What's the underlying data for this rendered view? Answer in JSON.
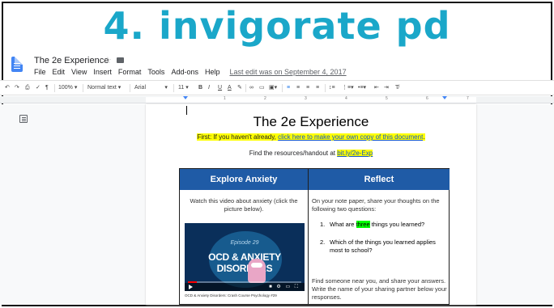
{
  "banner": {
    "text": "4. invigorate pd"
  },
  "docs": {
    "title": "The 2e Experience",
    "menu": [
      "File",
      "Edit",
      "View",
      "Insert",
      "Format",
      "Tools",
      "Add-ons",
      "Help"
    ],
    "last_edit": "Last edit was on September 4, 2017",
    "toolbar": {
      "zoom": "100%",
      "style": "Normal text",
      "font": "Arial",
      "size": "11",
      "bold": "B",
      "italic": "I",
      "underline": "U",
      "text_color": "A"
    },
    "ruler_numbers": [
      "1",
      "2",
      "3",
      "4",
      "5",
      "6",
      "7"
    ]
  },
  "document": {
    "heading": "The 2e Experience",
    "first_prefix": "First: If you haven't already, ",
    "first_link": "click here to make your own copy of this document",
    "first_suffix": ".",
    "resources_prefix": "Find the resources/handout at ",
    "resources_link": "bit.ly/2e-Exp",
    "table": {
      "col_a_header": "Explore Anxiety",
      "col_b_header": "Reflect",
      "col_a_text": "Watch this video about anxiety (click the picture below).",
      "video": {
        "episode": "Episode 29",
        "title": "OCD & ANXIETY DISORDERS",
        "progress": 0.08,
        "caption": "OCD & Anxiety Disorders: Crash Course Psychology #29"
      },
      "col_b_intro": "On your note paper, share your thoughts on the following two questions:",
      "q1_num": "1.",
      "q1_before": "What are ",
      "q1_highlight": "three",
      "q1_after": " things you learned?",
      "q2_num": "2.",
      "q2_text": "Which of the things you learned applies most to school?",
      "col_b_outro": "Find someone near you, and share your answers. Write the name of your sharing partner below your responses."
    }
  },
  "colors": {
    "banner": "#1aa7c9",
    "table_header": "#1f5ba6",
    "highlight_yellow": "#ffff00",
    "highlight_green": "#00ff00",
    "link": "#1155cc"
  }
}
